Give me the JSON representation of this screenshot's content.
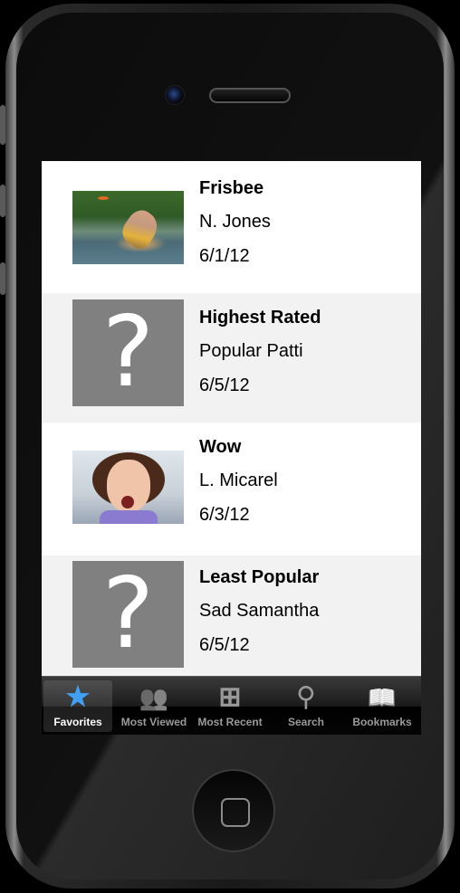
{
  "items": [
    {
      "title": "Frisbee",
      "author": "N. Jones",
      "date": "6/1/12",
      "thumbnail": "photo-frisbee"
    },
    {
      "title": "Highest Rated",
      "author": "Popular Patti",
      "date": "6/5/12",
      "thumbnail": "question-mark-placeholder"
    },
    {
      "title": "Wow",
      "author": "L. Micarel",
      "date": "6/3/12",
      "thumbnail": "photo-girl"
    },
    {
      "title": "Least Popular",
      "author": "Sad Samantha",
      "date": "6/5/12",
      "thumbnail": "question-mark-placeholder"
    }
  ],
  "placeholder_glyph": "?",
  "tabs": [
    {
      "label": "Favorites",
      "icon": "star-icon",
      "glyph": "★",
      "active": true
    },
    {
      "label": "Most Viewed",
      "icon": "people-icon",
      "glyph": "👥",
      "active": false
    },
    {
      "label": "Most Recent",
      "icon": "add-page-icon",
      "glyph": "⊞",
      "active": false
    },
    {
      "label": "Search",
      "icon": "search-icon",
      "glyph": "⚲",
      "active": false
    },
    {
      "label": "Bookmarks",
      "icon": "book-icon",
      "glyph": "📖",
      "active": false
    }
  ],
  "colors": {
    "active_tab_icon": "#3fa0f5",
    "placeholder_bg": "#808080",
    "row_alt_bg": "#f2f2f2"
  }
}
